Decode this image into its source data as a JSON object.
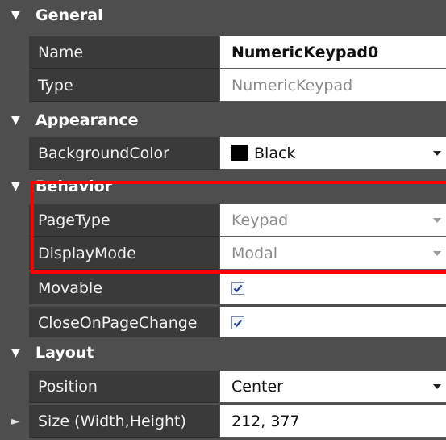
{
  "sections": {
    "general": "General",
    "appearance": "Appearance",
    "behavior": "Behavior",
    "layout": "Layout"
  },
  "properties": {
    "name": {
      "label": "Name",
      "value": "NumericKeypad0"
    },
    "type": {
      "label": "Type",
      "value": "NumericKeypad"
    },
    "background_color": {
      "label": "BackgroundColor",
      "value": "Black",
      "swatch": "#000000"
    },
    "page_type": {
      "label": "PageType",
      "value": "Keypad"
    },
    "display_mode": {
      "label": "DisplayMode",
      "value": "Modal"
    },
    "movable": {
      "label": "Movable",
      "checked": true
    },
    "close_on_page_change": {
      "label": "CloseOnPageChange",
      "checked": true
    },
    "position": {
      "label": "Position",
      "value": "Center"
    },
    "size": {
      "label": "Size (Width,Height)",
      "value": "212, 377"
    }
  },
  "glyphs": {
    "collapse": "▼",
    "expand": "►"
  },
  "colors": {
    "panel": "#4e4e4e",
    "name_cell": "#3a3a3a",
    "value_cell": "#ffffff",
    "highlight": "#ff0000"
  }
}
